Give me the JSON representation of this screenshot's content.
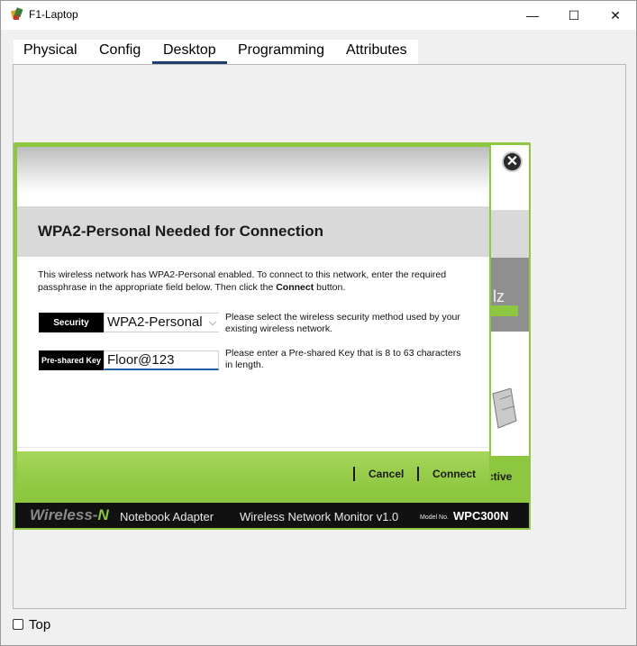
{
  "window": {
    "title": "F1-Laptop",
    "min_symbol": "—",
    "max_symbol": "☐",
    "close_symbol": "✕"
  },
  "tabs": [
    {
      "label": "Physical"
    },
    {
      "label": "Config"
    },
    {
      "label": "Desktop",
      "active": true
    },
    {
      "label": "Programming"
    },
    {
      "label": "Attributes"
    }
  ],
  "footer_option": {
    "label": "Top",
    "checked": false
  },
  "monitor": {
    "partial_z": "lz",
    "partial_active": "ctive",
    "close_symbol": "✕",
    "brand": {
      "wireless": "Wireless-",
      "n": "N",
      "adapter": "Notebook Adapter",
      "monitor": "Wireless Network Monitor  v1.0",
      "model_label": "Model No.",
      "model": "WPC300N"
    },
    "accent_color": "#8dc63f"
  },
  "dialog": {
    "title": "WPA2-Personal Needed for Connection",
    "desc_before": "This wireless network has WPA2-Personal enabled. To connect to this network, enter the required passphrase in the appropriate field below. Then click the ",
    "desc_bold": "Connect",
    "desc_after": " button.",
    "security_label": "Security",
    "security_value": "WPA2-Personal",
    "security_hint": "Please select the wireless security method used by your existing wireless network.",
    "psk_label": "Pre-shared Key",
    "psk_value": "Floor@123",
    "psk_hint": "Please enter a Pre-shared Key that is 8 to 63 characters in length.",
    "cancel_label": "Cancel",
    "connect_label": "Connect"
  }
}
